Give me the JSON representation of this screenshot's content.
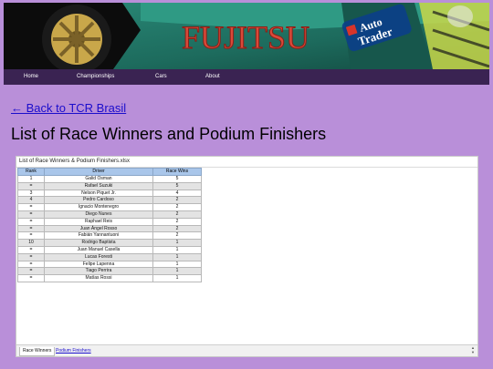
{
  "banner": {
    "sponsor_main": "FUJITSU",
    "sponsor_secondary_line1": "Auto",
    "sponsor_secondary_line2": "Trader"
  },
  "nav": {
    "items": [
      {
        "label": "Home"
      },
      {
        "label": "Championships"
      },
      {
        "label": "Cars"
      },
      {
        "label": "About"
      }
    ]
  },
  "back_link": "← Back to TCR Brasil",
  "page_title": "List of Race Winners and Podium Finishers",
  "sheet": {
    "file_name": "List of Race Winners & Podium Finishers.xlsx",
    "columns": [
      "Rank",
      "Driver",
      "Race Wins"
    ],
    "rows": [
      [
        "1",
        "Galid Osman",
        "5"
      ],
      [
        "=",
        "Rafael Suzuki",
        "5"
      ],
      [
        "3",
        "Nelson Piquet Jr.",
        "4"
      ],
      [
        "4",
        "Pedro Cardoso",
        "2"
      ],
      [
        "=",
        "Ignacio Montenegro",
        "2"
      ],
      [
        "=",
        "Diego Nunes",
        "2"
      ],
      [
        "=",
        "Raphael Reis",
        "2"
      ],
      [
        "=",
        "Juan Ángel Rosso",
        "2"
      ],
      [
        "=",
        "Fabián Yannantuoni",
        "2"
      ],
      [
        "10",
        "Rodrigo Baptista",
        "1"
      ],
      [
        "=",
        "Juan Manuel Casella",
        "1"
      ],
      [
        "=",
        "Lucas Foresti",
        "1"
      ],
      [
        "=",
        "Felipe Lapenna",
        "1"
      ],
      [
        "=",
        "Tiago Perrira",
        "1"
      ],
      [
        "=",
        "Matías Rossi",
        "1"
      ]
    ],
    "tabs": [
      {
        "label": "Race Winners",
        "active": true
      },
      {
        "label": "Podium Finishers",
        "active": false
      }
    ]
  },
  "colors": {
    "page_background": "#b98fd9",
    "nav_background": "#3a2352",
    "header_cell": "#a9c6ea",
    "link": "#1a0dcc"
  }
}
